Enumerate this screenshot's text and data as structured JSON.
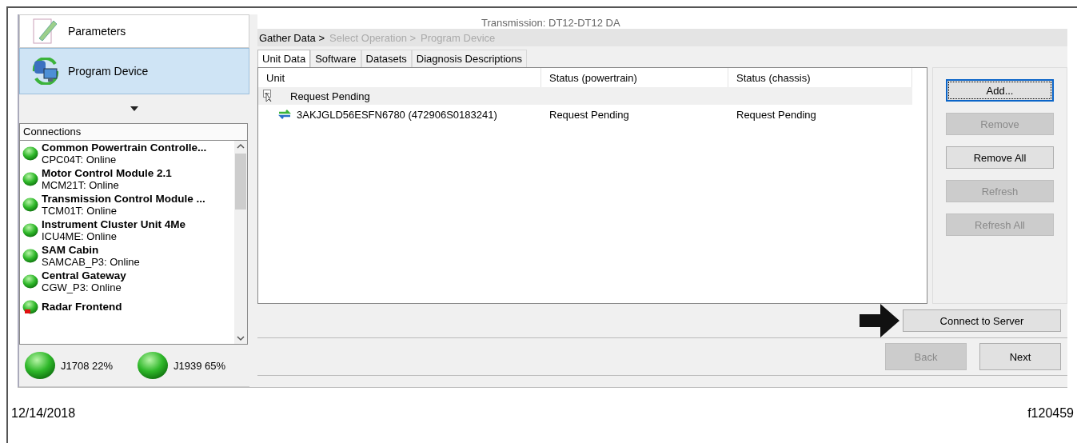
{
  "nav": [
    {
      "label": "Parameters",
      "selected": false,
      "kind": "parameters"
    },
    {
      "label": "Program Device",
      "selected": true,
      "kind": "program"
    }
  ],
  "connections": {
    "title": "Connections",
    "items": [
      {
        "name": "Common Powertrain Controlle...",
        "status": "CPC04T: Online",
        "alert": false
      },
      {
        "name": "Motor Control Module 2.1",
        "status": "MCM21T: Online",
        "alert": false
      },
      {
        "name": "Transmission Control Module ...",
        "status": "TCM01T: Online",
        "alert": false
      },
      {
        "name": "Instrument Cluster Unit 4Me",
        "status": "ICU4ME: Online",
        "alert": false
      },
      {
        "name": "SAM Cabin",
        "status": "SAMCAB_P3: Online",
        "alert": false
      },
      {
        "name": "Central Gateway",
        "status": "CGW_P3: Online",
        "alert": false
      },
      {
        "name": "Radar Frontend",
        "alert": true
      }
    ]
  },
  "buses": [
    {
      "label": "J1708 22%"
    },
    {
      "label": "J1939 65%"
    }
  ],
  "header": {
    "vehicle_info": "Transmission: DT12-DT12 DA"
  },
  "breadcrumb": [
    {
      "label": "Gather Data >",
      "selected": true
    },
    {
      "label": "Select Operation >",
      "selected": false
    },
    {
      "label": "Program Device",
      "selected": false
    }
  ],
  "tabs": [
    {
      "label": "Unit Data",
      "selected": true
    },
    {
      "label": "Software",
      "selected": false
    },
    {
      "label": "Datasets",
      "selected": false
    },
    {
      "label": "Diagnosis Descriptions",
      "selected": false
    }
  ],
  "table": {
    "columns": [
      "Unit",
      "Status (powertrain)",
      "Status (chassis)"
    ],
    "groups": [
      {
        "label": "Request Pending",
        "rows": [
          [
            "3AKJGLD56ESFN6780 (472906S0183241)",
            "Request Pending",
            "Request Pending"
          ]
        ]
      }
    ]
  },
  "side_buttons": [
    {
      "label": "Add...",
      "disabled": false,
      "focused": true
    },
    {
      "label": "Remove",
      "disabled": true,
      "focused": false
    },
    {
      "label": "Remove All",
      "disabled": false,
      "focused": false
    },
    {
      "label": "Refresh",
      "disabled": true,
      "focused": false
    },
    {
      "label": "Refresh All",
      "disabled": true,
      "focused": false
    }
  ],
  "connect_button": {
    "label": "Connect to Server"
  },
  "nav_buttons": [
    {
      "label": "Back",
      "disabled": true
    },
    {
      "label": "Next",
      "disabled": false
    }
  ],
  "caption": {
    "date": "12/14/2018",
    "figure_id": "f120459"
  }
}
